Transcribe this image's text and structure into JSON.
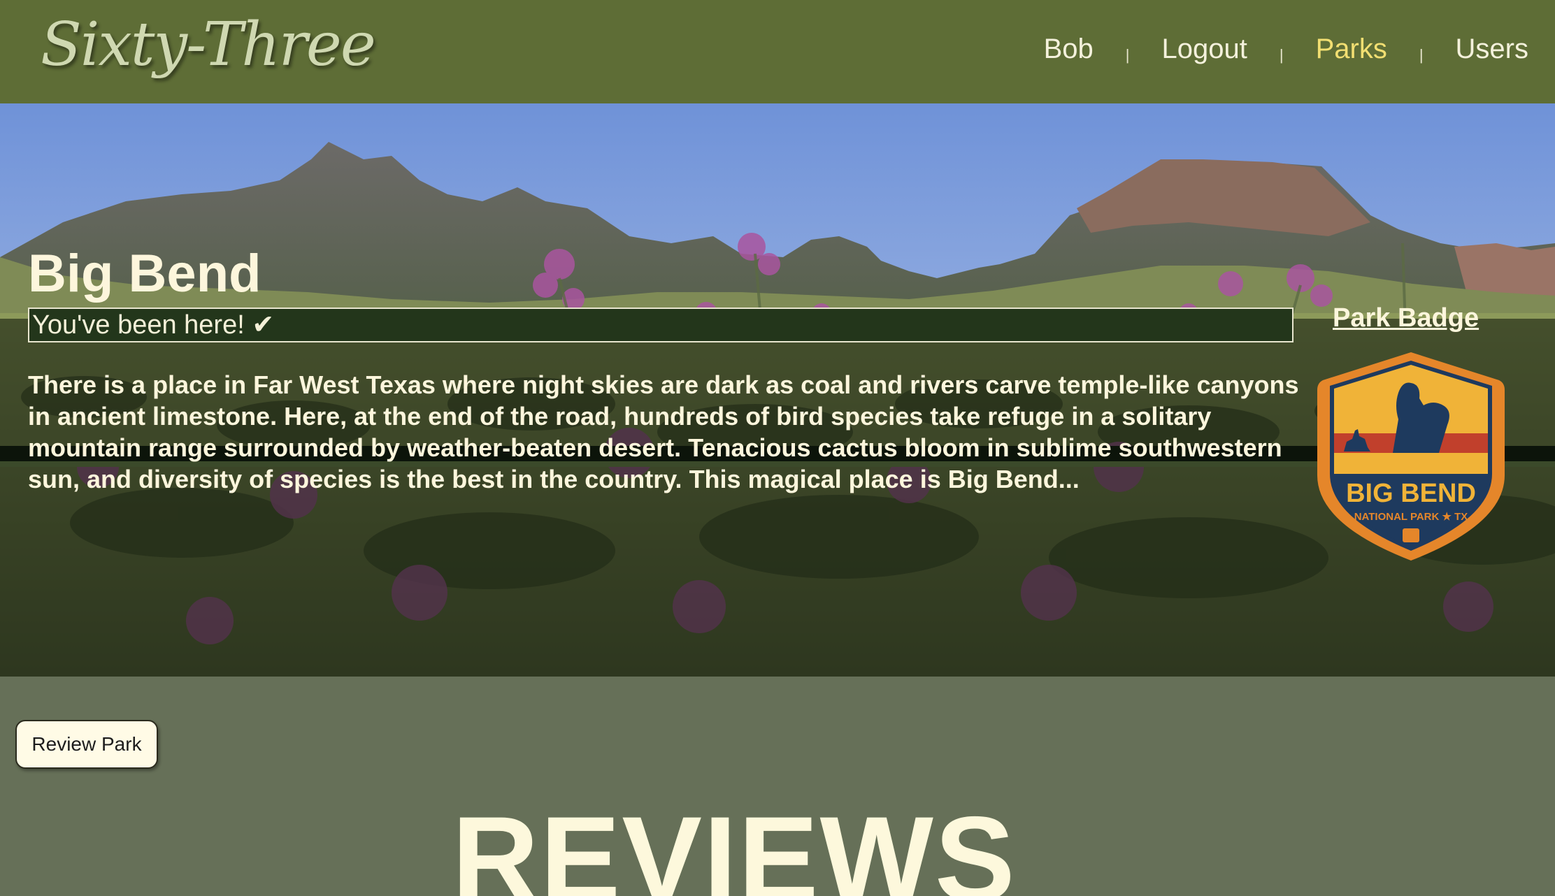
{
  "app": {
    "logo_text": "Sixty-Three"
  },
  "nav": {
    "items": [
      {
        "label": "Bob",
        "active": false
      },
      {
        "label": "Logout",
        "active": false
      },
      {
        "label": "Parks",
        "active": true
      },
      {
        "label": "Users",
        "active": false
      }
    ],
    "separator": "|",
    "active_color": "#f2df72"
  },
  "park": {
    "name": "Big Bend",
    "visited_text": "You've been here! ✔",
    "description": "There is a place in Far West Texas where night skies are dark as coal and rivers carve temple-like canyons in ancient limestone. Here, at the end of the road, hundreds of bird species take refuge in a solitary mountain range surrounded by weather-beaten desert. Tenacious cactus bloom in sublime southwestern sun, and diversity of species is the best in the country. This magical place is Big Bend...",
    "badge_label": "Park Badge",
    "badge": {
      "title": "BIG BEND",
      "subtitle": "NATIONAL PARK ★ TX"
    }
  },
  "actions": {
    "review_button": "Review Park"
  },
  "reviews": {
    "heading": "REVIEWS"
  },
  "colors": {
    "navbar_bg": "#5e6d36",
    "page_bg": "#667058",
    "text_cream": "#fdf6dc"
  }
}
